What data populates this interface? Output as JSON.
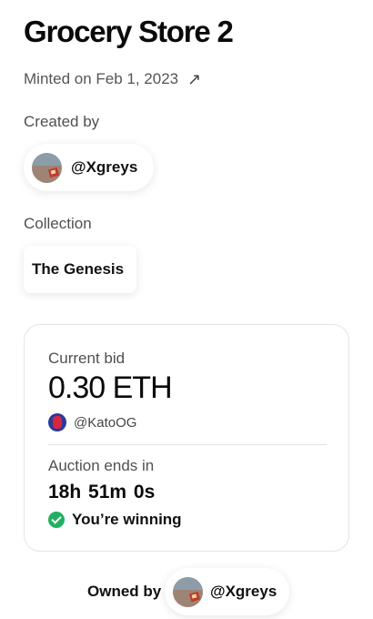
{
  "header": {
    "title": "Grocery Store 2",
    "minted_text": "Minted on Feb 1, 2023",
    "minted_link_icon": "arrow-up-right-icon"
  },
  "creator": {
    "label": "Created by",
    "username": "@Xgreys"
  },
  "collection": {
    "label": "Collection",
    "name": "The Genesis"
  },
  "bid": {
    "label": "Current bid",
    "amount": "0.30 ETH",
    "bidder": "@KatoOG",
    "auction_label": "Auction ends in",
    "countdown": "18h 51m 0s",
    "status": "You’re winning",
    "status_color": "#21b161"
  },
  "owner": {
    "label": "Owned by",
    "username": "@Xgreys"
  }
}
